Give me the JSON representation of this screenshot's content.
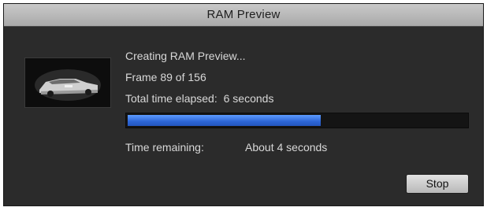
{
  "dialog": {
    "title": "RAM Preview",
    "thumbnail_icon": "car-thumbnail"
  },
  "status": {
    "message": "Creating RAM Preview...",
    "frame_text": "Frame 89 of 156",
    "elapsed_label": "Total time elapsed:",
    "elapsed_value": "6 seconds",
    "remaining_label": "Time remaining:",
    "remaining_value": "About 4 seconds"
  },
  "progress": {
    "fraction": 0.57,
    "fill_color": "#2c65d6"
  },
  "buttons": {
    "stop_label": "Stop"
  }
}
